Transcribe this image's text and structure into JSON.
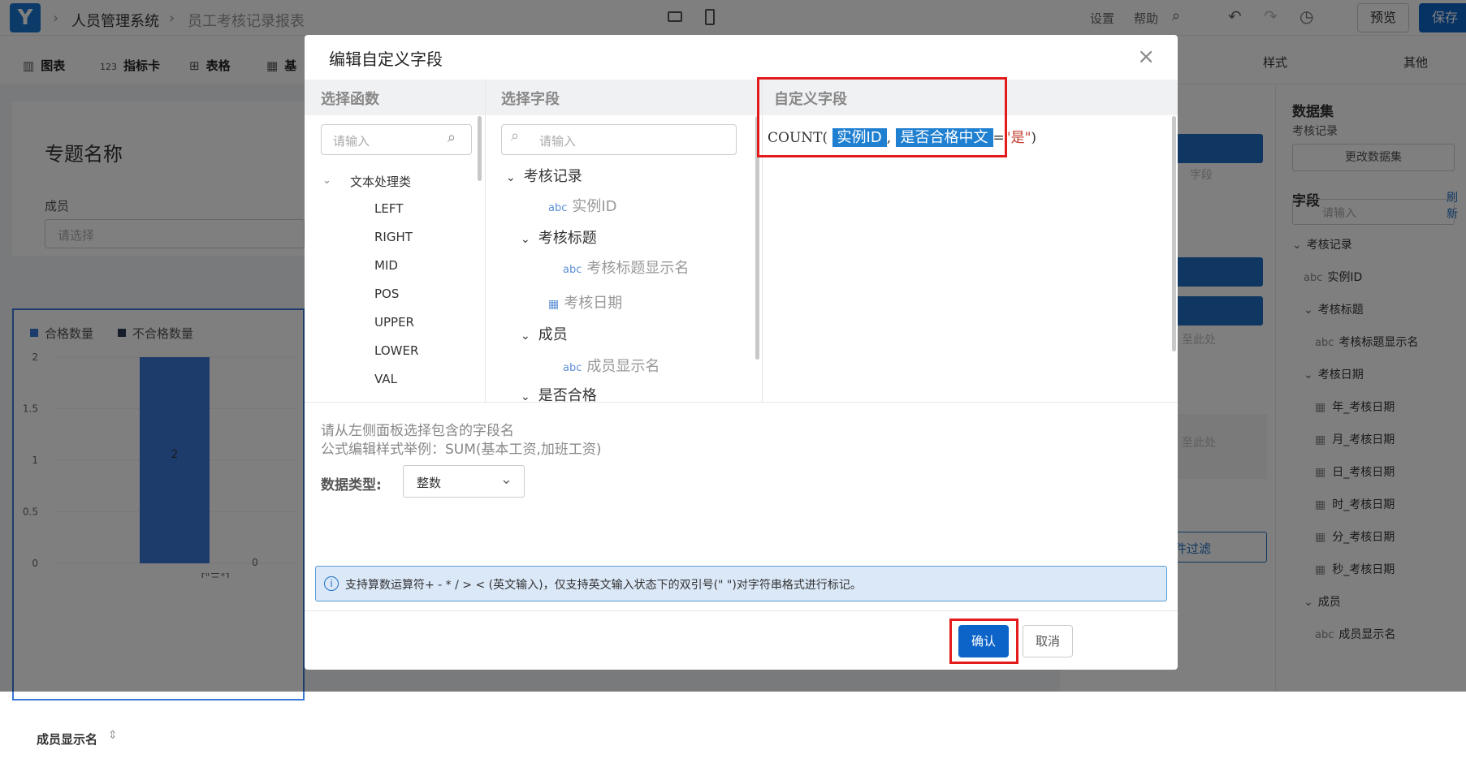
{
  "topbar": {
    "logo": "Y",
    "breadcrumb": [
      "人员管理系统",
      "员工考核记录报表"
    ],
    "settings": "设置",
    "help": "帮助",
    "preview": "预览",
    "save": "保存"
  },
  "toolbar": {
    "items": [
      {
        "icon": "chart-icon",
        "label": "图表"
      },
      {
        "icon": "123",
        "label": "指标卡"
      },
      {
        "icon": "table-icon",
        "label": "表格"
      },
      {
        "icon": "grid-icon",
        "label": "基"
      }
    ],
    "right_tabs": [
      "样式",
      "其他"
    ]
  },
  "canvas": {
    "topic": "专题名称",
    "member_label": "成员",
    "member_placeholder": "请选择",
    "legend": [
      "合格数量",
      "不合格数量"
    ],
    "y_ticks": [
      "2",
      "1.5",
      "1",
      "0.5",
      "0"
    ],
    "x_label": "[\"三\"]",
    "bar_value": "2",
    "zero_label": "0",
    "table_header": "成员显示名"
  },
  "chart_data": {
    "type": "bar",
    "categories": [
      "[\"三\"]"
    ],
    "series": [
      {
        "name": "合格数量",
        "values": [
          2
        ]
      },
      {
        "name": "不合格数量",
        "values": [
          0
        ]
      }
    ],
    "ylim": [
      0,
      2
    ]
  },
  "rightpanel": {
    "dataset_title": "数据集",
    "dataset_name": "考核记录",
    "change_dataset": "更改数据集",
    "fields_title": "字段",
    "refresh": "刷新",
    "search_placeholder": "请输入",
    "tree": [
      {
        "level": 0,
        "label": "考核记录",
        "type": "group"
      },
      {
        "level": 1,
        "label": "实例ID",
        "type": "abc"
      },
      {
        "level": 1,
        "label": "考核标题",
        "type": "group"
      },
      {
        "level": 2,
        "label": "考核标题显示名",
        "type": "abc"
      },
      {
        "level": 1,
        "label": "考核日期",
        "type": "group"
      },
      {
        "level": 2,
        "label": "年_考核日期",
        "type": "date"
      },
      {
        "level": 2,
        "label": "月_考核日期",
        "type": "date"
      },
      {
        "level": 2,
        "label": "日_考核日期",
        "type": "date"
      },
      {
        "level": 2,
        "label": "时_考核日期",
        "type": "date"
      },
      {
        "level": 2,
        "label": "分_考核日期",
        "type": "date"
      },
      {
        "level": 2,
        "label": "秒_考核日期",
        "type": "date"
      },
      {
        "level": 1,
        "label": "成员",
        "type": "group"
      },
      {
        "level": 2,
        "label": "成员显示名",
        "type": "abc"
      }
    ]
  },
  "midpanel": {
    "drop_text1": "字段",
    "drop_text2": "至此处",
    "drop_text3": "至此处",
    "filter_btn": "件过滤"
  },
  "modal": {
    "title": "编辑自定义字段",
    "col1": {
      "header": "选择函数",
      "search_placeholder": "请输入",
      "category": "文本处理类",
      "functions": [
        "LEFT",
        "RIGHT",
        "MID",
        "POS",
        "UPPER",
        "LOWER",
        "VAL"
      ]
    },
    "col2": {
      "header": "选择字段",
      "search_placeholder": "请输入",
      "tree": [
        {
          "label": "考核记录",
          "kind": "group",
          "level": 0
        },
        {
          "label": "实例ID",
          "kind": "abc",
          "level": 1
        },
        {
          "label": "考核标题",
          "kind": "group",
          "level": 1
        },
        {
          "label": "考核标题显示名",
          "kind": "abc",
          "level": 2
        },
        {
          "label": "考核日期",
          "kind": "date",
          "level": 1
        },
        {
          "label": "成员",
          "kind": "group",
          "level": 1
        },
        {
          "label": "成员显示名",
          "kind": "abc",
          "level": 2
        },
        {
          "label": "是否合格",
          "kind": "group",
          "level": 1
        }
      ]
    },
    "col3": {
      "header": "自定义字段",
      "fn": "COUNT",
      "open": "(",
      "tag1": "实例ID",
      "comma": ",",
      "tag2": "是否合格中文",
      "eq": "=",
      "str": "\"是\"",
      "close": ")"
    },
    "hint1": "请从左侧面板选择包含的字段名",
    "hint2": "公式编辑样式举例：SUM(基本工资,加班工资)",
    "datatype_label": "数据类型:",
    "datatype_value": "整数",
    "info": "支持算数运算符+ - * / > < (英文输入)，仅支持英文输入状态下的双引号(\" \")对字符串格式进行标记。",
    "confirm": "确认",
    "cancel": "取消"
  }
}
